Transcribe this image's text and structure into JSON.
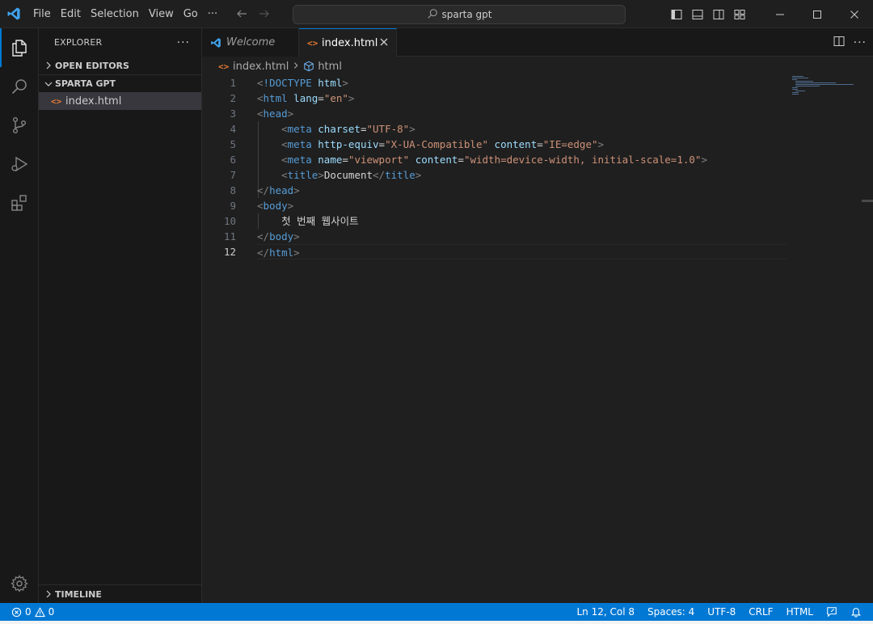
{
  "titlebar": {
    "menu": [
      "File",
      "Edit",
      "Selection",
      "View",
      "Go"
    ],
    "more": "···",
    "search_text": "sparta gpt"
  },
  "activity": {
    "items": [
      "explorer-icon",
      "search-icon",
      "source-control-icon",
      "run-debug-icon",
      "extensions-icon"
    ],
    "bottom": "gear-icon"
  },
  "sidebar": {
    "title": "EXPLORER",
    "more": "···",
    "open_editors": "OPEN EDITORS",
    "folder": "SPARTA GPT",
    "file": "index.html",
    "timeline": "TIMELINE"
  },
  "tabs": [
    {
      "label": "Welcome",
      "active": false
    },
    {
      "label": "index.html",
      "active": true
    }
  ],
  "breadcrumb": {
    "file": "index.html",
    "symbol": "html"
  },
  "editor": {
    "current_line": 12,
    "line_numbers": [
      "1",
      "2",
      "3",
      "4",
      "5",
      "6",
      "7",
      "8",
      "9",
      "10",
      "11",
      "12"
    ]
  },
  "status": {
    "errors": "0",
    "warnings": "0",
    "position": "Ln 12, Col 8",
    "spaces": "Spaces: 4",
    "encoding": "UTF-8",
    "eol": "CRLF",
    "language": "HTML"
  },
  "colors": {
    "accent": "#0078d4",
    "status_bar": "#0078d4",
    "html_icon": "#e37933",
    "vscode_logo": "#3fa4f0"
  }
}
